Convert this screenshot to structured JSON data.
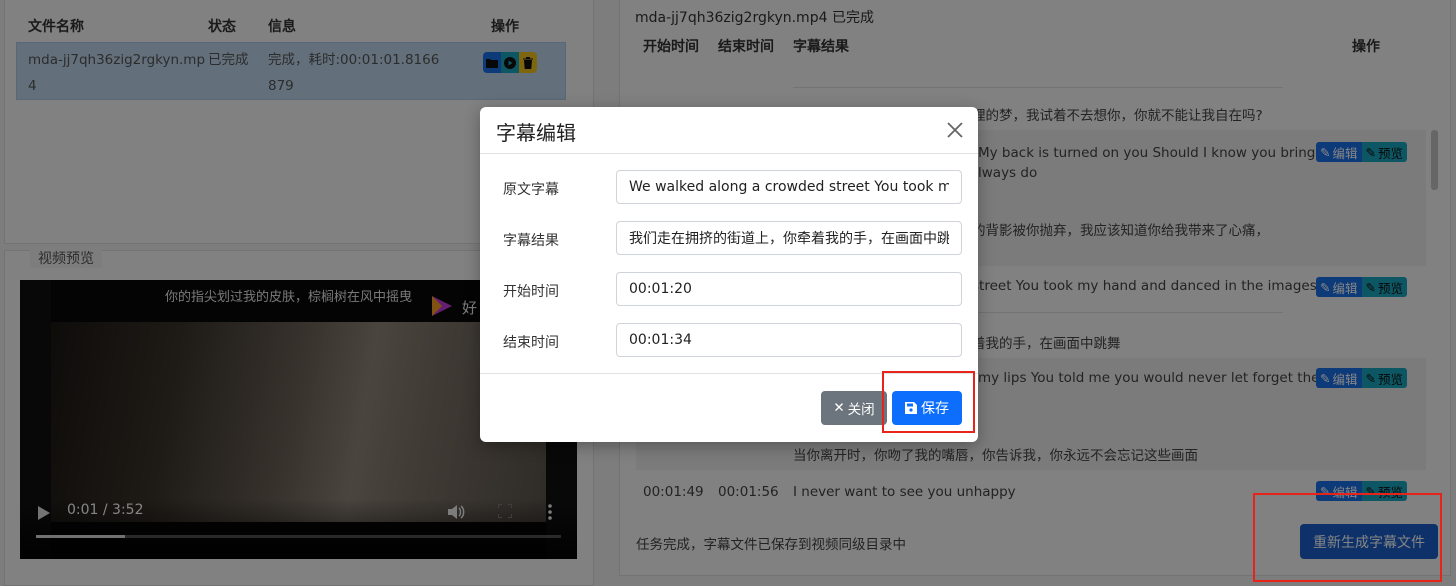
{
  "file_table": {
    "headers": {
      "name": "文件名称",
      "status": "状态",
      "info": "信息",
      "action": "操作"
    },
    "rows": [
      {
        "name_line1": "mda-jj7qh36zig2rgkyn.mp",
        "name_line2": "4",
        "status": "已完成",
        "info_line1": "完成，耗时:00:01:01.8166",
        "info_line2": "879"
      }
    ]
  },
  "video_preview": {
    "legend": "视频预览",
    "subtitle": "你的指尖划过我的皮肤，棕榈树在风中摇曳",
    "logo_text": "好",
    "time": "0:01 / 3:52",
    "progress": 0.17
  },
  "subtitle_panel": {
    "title": "mda-jj7qh36zig2rgkyn.mp4 已完成",
    "headers": {
      "start": "开始时间",
      "end": "结束时间",
      "result": "字幕结果",
      "action": "操作"
    },
    "rows": [
      {
        "result": "理的梦，我试着不去想你，你就不能让我自在吗?"
      },
      {
        "result": "My back is turned on you Should I know you bring",
        "result2": "lways do",
        "result3": "的背影被你抛弃，我应该知道你给我带来了心痛，",
        "edit": "编辑",
        "preview": "预览"
      },
      {
        "result": "street You took my hand and danced in the images",
        "result2": "着我的手，在画面中跳舞",
        "edit": "编辑",
        "preview": "预览"
      },
      {
        "result": "my lips You told me you would never let forget thes",
        "result2": "当你离开时，你吻了我的嘴唇，你告诉我，你永远不会忘记这些画面",
        "edit": "编辑",
        "preview": "预览"
      },
      {
        "start": "00:01:49",
        "end": "00:01:56",
        "result": "I never want to see you unhappy",
        "edit": "编辑",
        "preview": "预览"
      }
    ],
    "status": "任务完成，字幕文件已保存到视频同级目录中",
    "regenerate": "重新生成字幕文件"
  },
  "modal": {
    "title": "字幕编辑",
    "fields": {
      "original_label": "原文字幕",
      "original_value": "We walked along a crowded street You took my hand",
      "result_label": "字幕结果",
      "result_value": "我们走在拥挤的街道上，你牵着我的手，在画面中跳舞",
      "start_label": "开始时间",
      "start_value": "00:01:20",
      "end_label": "结束时间",
      "end_value": "00:01:34"
    },
    "close_label": "关闭",
    "save_label": "保存"
  },
  "colors": {
    "primary": "#0d6efd",
    "secondary": "#6c757d",
    "info": "#1aa6be",
    "highlight": "#e8231a",
    "selected_row": "#bfd7ee"
  }
}
